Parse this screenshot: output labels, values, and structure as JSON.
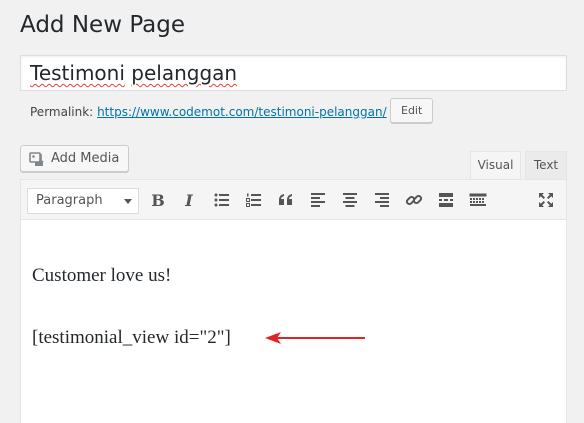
{
  "page": {
    "title": "Add New Page"
  },
  "title_field": {
    "value_part1": "Testimoni",
    "value_part2": "pelanggan"
  },
  "permalink": {
    "label": "Permalink:",
    "url_base": "https://www.codemot.com/",
    "slug": "testimoni-pelanggan",
    "url_tail": "/",
    "edit_label": "Edit"
  },
  "media": {
    "add_label": "Add Media"
  },
  "editor_tabs": {
    "visual": "Visual",
    "text": "Text",
    "active": "Visual"
  },
  "toolbar": {
    "format": "Paragraph",
    "bold": "B",
    "italic": "I",
    "icons": [
      "bullet-list-icon",
      "numbered-list-icon",
      "blockquote-icon",
      "align-left-icon",
      "align-center-icon",
      "align-right-icon",
      "insert-link-icon",
      "read-more-icon",
      "toolbar-toggle-icon",
      "fullscreen-icon"
    ]
  },
  "content": {
    "paragraphs": [
      "Customer love us!",
      "[testimonial_view id=\"2\"]"
    ]
  },
  "annotation": {
    "arrow_color": "#e02424"
  },
  "colors": {
    "link": "#0073aa",
    "spellcheck": "#e64040"
  }
}
